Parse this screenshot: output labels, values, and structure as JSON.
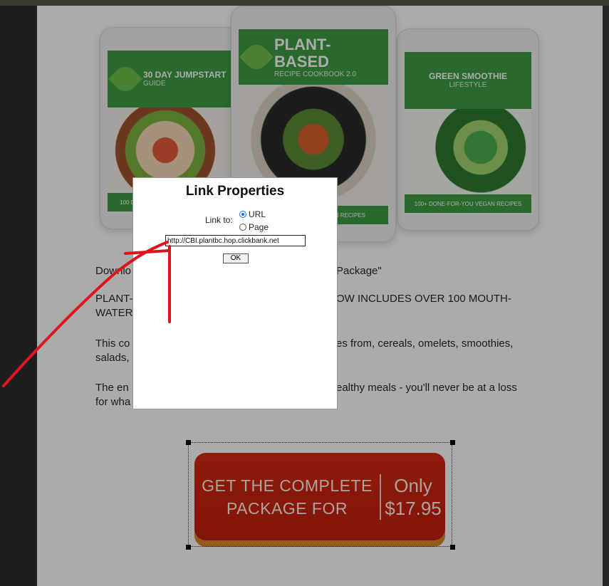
{
  "books": [
    {
      "title": "30 Day Jumpstart",
      "subtitle": "Guide",
      "footer": "100 Done-For-You Vegan Recipes"
    },
    {
      "title": "Plant-Based",
      "subtitle": "Recipe Cookbook 2.0",
      "footer": "100 Done-For-You Vegan Recipes"
    },
    {
      "title": "Green Smoothie",
      "subtitle": "Lifestyle",
      "footer": "100+ Done-For-You Vegan Recipes"
    }
  ],
  "body": {
    "p1_left": "Downlo",
    "p1_right": "Package\"",
    "p2_left": "PLANT-",
    "p2_right": "OW INCLUDES OVER 100 MOUTH-",
    "p2_line2": "WATER",
    "p3_left": "This co",
    "p3_right": "es from, cereals, omelets, smoothies,",
    "p3_line2": "salads,",
    "p4_left": "The en",
    "p4_right": "ealthy meals - you'll never be at a loss",
    "p4_line2": "for wha"
  },
  "cta": {
    "line1": "GET THE COMPLETE",
    "line2": "PACKAGE FOR",
    "price_label": "Only",
    "price": "$17.95",
    "colors": {
      "button": "#c9210f",
      "shadow": "#d98a26"
    }
  },
  "dialog": {
    "title": "Link Properties",
    "link_to_label": "Link to:",
    "options": [
      {
        "label": "URL",
        "selected": true
      },
      {
        "label": "Page",
        "selected": false
      }
    ],
    "url_value": "http://CBI.plantbc.hop.clickbank.net",
    "ok_label": "OK"
  },
  "annotation": {
    "color": "#e0141e"
  }
}
